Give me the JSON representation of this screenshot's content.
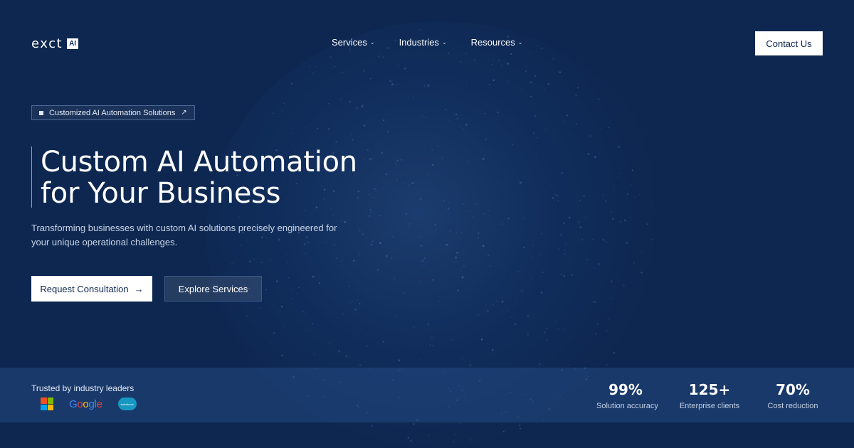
{
  "header": {
    "logo_text": "exct",
    "logo_badge": "AI",
    "nav": [
      {
        "label": "Services"
      },
      {
        "label": "Industries"
      },
      {
        "label": "Resources"
      }
    ],
    "contact_label": "Contact Us"
  },
  "hero": {
    "tagline": "Customized AI Automation Solutions",
    "title_line1": "Custom AI Automation",
    "title_line2": "for Your Business",
    "subtitle": "Transforming businesses with custom AI solutions precisely engineered for your unique operational challenges.",
    "primary_button": "Request Consultation",
    "secondary_button": "Explore Services"
  },
  "trust": {
    "heading": "Trusted by industry leaders",
    "brands": [
      "microsoft-logo",
      "google-logo",
      "salesforce-logo"
    ],
    "google_text": "Google",
    "salesforce_text": "salesforce"
  },
  "stats": [
    {
      "value": "99%",
      "label": "Solution accuracy"
    },
    {
      "value": "125+",
      "label": "Enterprise clients"
    },
    {
      "value": "70%",
      "label": "Cost reduction"
    }
  ],
  "colors": {
    "background": "#0d2750",
    "accent_white": "#ffffff",
    "band": "#234a84"
  },
  "icons": {
    "nav_chevron": "chevron-down-icon",
    "tagline_square": "square-bullet-icon",
    "tagline_arrow": "arrow-up-right-icon",
    "primary_arrow": "arrow-right-icon"
  }
}
